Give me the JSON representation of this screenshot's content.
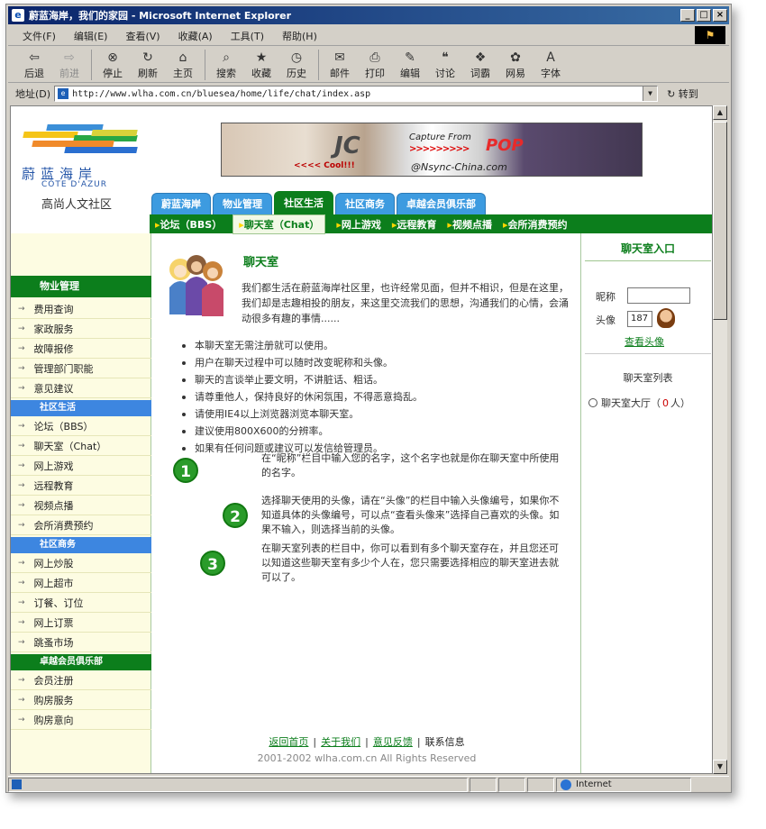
{
  "window": {
    "title": "蔚蓝海岸，我们的家园 - Microsoft Internet Explorer"
  },
  "menu": [
    "文件(F)",
    "编辑(E)",
    "查看(V)",
    "收藏(A)",
    "工具(T)",
    "帮助(H)"
  ],
  "toolbar": [
    {
      "label": "后退",
      "icon": "back-arrow-icon",
      "enabled": true
    },
    {
      "label": "前进",
      "icon": "forward-arrow-icon",
      "enabled": false
    },
    {
      "label": "停止",
      "icon": "stop-icon",
      "enabled": true
    },
    {
      "label": "刷新",
      "icon": "refresh-icon",
      "enabled": true
    },
    {
      "label": "主页",
      "icon": "home-icon",
      "enabled": true
    },
    {
      "label": "搜索",
      "icon": "search-icon",
      "enabled": true
    },
    {
      "label": "收藏",
      "icon": "favorites-icon",
      "enabled": true
    },
    {
      "label": "历史",
      "icon": "history-icon",
      "enabled": true
    },
    {
      "label": "邮件",
      "icon": "mail-icon",
      "enabled": true
    },
    {
      "label": "打印",
      "icon": "print-icon",
      "enabled": true
    },
    {
      "label": "编辑",
      "icon": "edit-icon",
      "enabled": true
    },
    {
      "label": "讨论",
      "icon": "discuss-icon",
      "enabled": true
    },
    {
      "label": "词霸",
      "icon": "dictionary-icon",
      "enabled": true
    },
    {
      "label": "网易",
      "icon": "netease-icon",
      "enabled": true
    },
    {
      "label": "字体",
      "icon": "font-icon",
      "enabled": true
    }
  ],
  "address": {
    "label": "地址(D)",
    "url": "http://www.wlha.com.cn/bluesea/home/life/chat/index.asp",
    "go": "转到"
  },
  "status": {
    "zone": "Internet"
  },
  "logo": {
    "cn": "蔚蓝海岸",
    "fr": "CÔTE D'AZUR",
    "sub": "高尚人文社区"
  },
  "banner": {
    "jc": "JC",
    "cool": "<<<< Cool!!!",
    "capture": "Capture From",
    "arrows": ">>>>>>>>>",
    "pop": "POP",
    "site": "@Nsync-China.com"
  },
  "tabs": [
    {
      "label": "蔚蓝海岸",
      "active": false
    },
    {
      "label": "物业管理",
      "active": false
    },
    {
      "label": "社区生活",
      "active": true
    },
    {
      "label": "社区商务",
      "active": false
    },
    {
      "label": "卓越会员俱乐部",
      "active": false
    }
  ],
  "subnav": [
    {
      "label": "论坛（BBS）",
      "active": false
    },
    {
      "label": "聊天室（Chat）",
      "active": true
    },
    {
      "label": "网上游戏",
      "active": false
    },
    {
      "label": "远程教育",
      "active": false
    },
    {
      "label": "视频点播",
      "active": false
    },
    {
      "label": "会所消费预约",
      "active": false
    }
  ],
  "sidebar": {
    "g1": {
      "title": "物业管理",
      "items": [
        "费用查询",
        "家政服务",
        "故障报修",
        "管理部门职能",
        "意见建议"
      ]
    },
    "g2": {
      "title": "社区生活",
      "items": [
        "论坛（BBS）",
        "聊天室（Chat）",
        "网上游戏",
        "远程教育",
        "视频点播",
        "会所消费预约"
      ]
    },
    "g3": {
      "title": "社区商务",
      "items": [
        "网上炒股",
        "网上超市",
        "订餐、订位",
        "网上订票",
        "跳蚤市场"
      ]
    },
    "g4": {
      "title": "卓越会员俱乐部",
      "items": [
        "会员注册",
        "购房服务",
        "购房意向"
      ]
    }
  },
  "main": {
    "title": "聊天室",
    "intro": "我们都生活在蔚蓝海岸社区里，也许经常见面，但并不相识，但是在这里，我们却是志趣相投的朋友，来这里交流我们的思想，沟通我们的心情，会涌动很多有趣的事情......",
    "rules": [
      "本聊天室无需注册就可以使用。",
      "用户在聊天过程中可以随时改变昵称和头像。",
      "聊天的言谈举止要文明，不讲脏话、粗话。",
      "请尊重他人，保持良好的休闲氛围，不得恶意捣乱。",
      "请使用IE4以上浏览器浏览本聊天室。",
      "建议使用800X600的分辨率。",
      "如果有任何问题或建议可以发信给管理员。"
    ],
    "steps": [
      {
        "num": "1",
        "text": "在“昵称”栏目中输入您的名字，这个名字也就是你在聊天室中所使用的名字。"
      },
      {
        "num": "2",
        "text": "选择聊天使用的头像，请在“头像”的栏目中输入头像编号，如果你不知道具体的头像编号，可以点“查看头像来”选择自己喜欢的头像。如果不输入，则选择当前的头像。"
      },
      {
        "num": "3",
        "text": "在聊天室列表的栏目中，你可以看到有多个聊天室存在，并且您还可以知道这些聊天室有多少个人在，您只需要选择相应的聊天室进去就可以了。"
      }
    ]
  },
  "footer": {
    "links": [
      "返回首页",
      "关于我们",
      "意见反馈"
    ],
    "contact": "联系信息",
    "copyright": "2001-2002 wlha.com.cn  All Rights Reserved"
  },
  "right": {
    "title": "聊天室入口",
    "nick_label": "昵称",
    "avatar_label": "头像",
    "avatar_value": "187",
    "view_avatar": "查看头像",
    "list_title": "聊天室列表",
    "room_name": "聊天室大厅（",
    "room_count": "0",
    "room_suffix": "人）"
  }
}
